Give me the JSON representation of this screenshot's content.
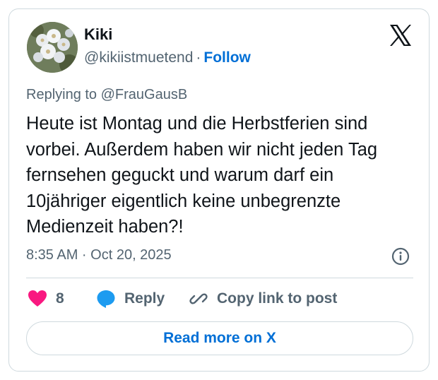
{
  "author": {
    "name": "Kiki",
    "handle": "@kikiistmuetend",
    "separator": "·",
    "follow_label": "Follow",
    "avatar_icon": "flower-avatar"
  },
  "brand": {
    "logo_icon": "x-logo-icon"
  },
  "tweet": {
    "replying_to": "Replying to @FrauGausB",
    "text": "Heute ist Montag und die Herbstferien sind vorbei. Außerdem haben wir nicht jeden Tag fernsehen geguckt und warum darf ein 10jähriger eigentlich keine unbegrenzte Medienzeit haben?!",
    "timestamp": "8:35 AM · Oct 20, 2025"
  },
  "actions": {
    "like_count": "8",
    "reply_label": "Reply",
    "copy_label": "Copy link to post"
  },
  "footer": {
    "read_more_label": "Read more on X"
  },
  "colors": {
    "like": "#f91880",
    "reply": "#1d9bf0",
    "link": "#006fd6",
    "muted": "#536471",
    "border": "#cfd9de"
  }
}
